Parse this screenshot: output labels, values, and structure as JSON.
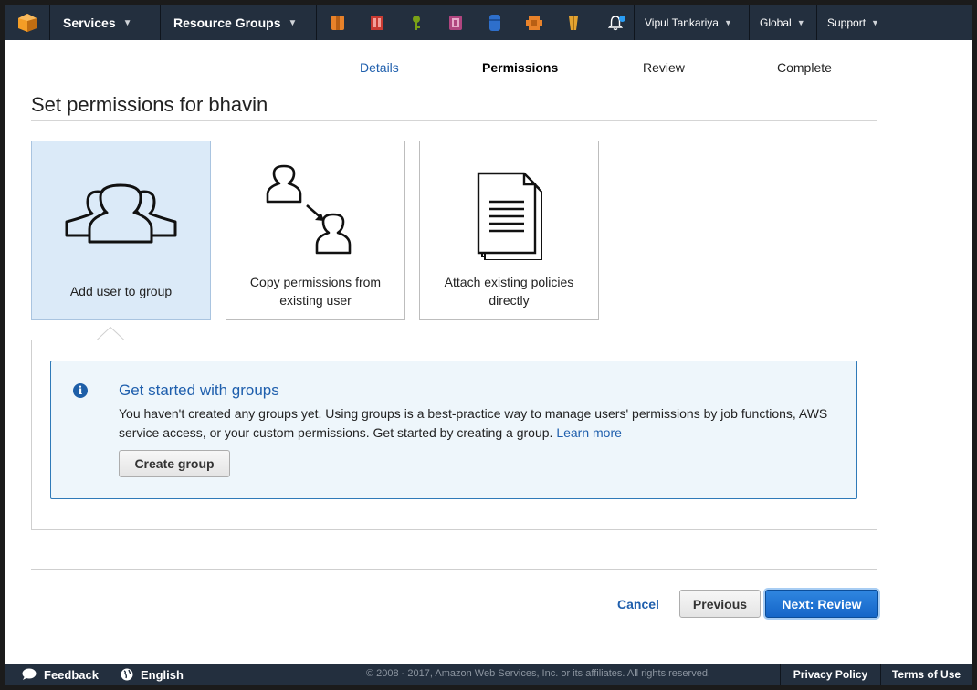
{
  "nav": {
    "services_label": "Services",
    "resource_groups_label": "Resource Groups",
    "service_icons": [
      {
        "name": "ec2-icon",
        "color": "#e8822a"
      },
      {
        "name": "rds-icon",
        "color": "#d0443a"
      },
      {
        "name": "iam-icon",
        "color": "#7aa116"
      },
      {
        "name": "cloudformation-icon",
        "color": "#b0457f"
      },
      {
        "name": "dynamodb-icon",
        "color": "#2e6fcb"
      },
      {
        "name": "lambda-icon",
        "color": "#e8822a"
      },
      {
        "name": "s3-icon",
        "color": "#e3a331"
      }
    ],
    "user_label": "Vipul Tankariya",
    "region_label": "Global",
    "support_label": "Support"
  },
  "steps": {
    "details": "Details",
    "permissions": "Permissions",
    "review": "Review",
    "complete": "Complete"
  },
  "page": {
    "title": "Set permissions for bhavin"
  },
  "options": [
    {
      "label": "Add user to group",
      "selected": true
    },
    {
      "label": "Copy permissions from existing user",
      "selected": false
    },
    {
      "label": "Attach existing policies directly",
      "selected": false
    }
  ],
  "info": {
    "title": "Get started with groups",
    "text": "You haven't created any groups yet. Using groups is a best-practice way to manage users' permissions by job functions, AWS service access, or your custom permissions. Get started by creating a group.",
    "learn_more": "Learn more",
    "create_button": "Create group"
  },
  "actions": {
    "cancel": "Cancel",
    "previous": "Previous",
    "next": "Next: Review"
  },
  "footer": {
    "feedback": "Feedback",
    "language": "English",
    "copyright": "© 2008 - 2017, Amazon Web Services, Inc. or its affiliates. All rights reserved.",
    "privacy": "Privacy Policy",
    "terms": "Terms of Use"
  }
}
